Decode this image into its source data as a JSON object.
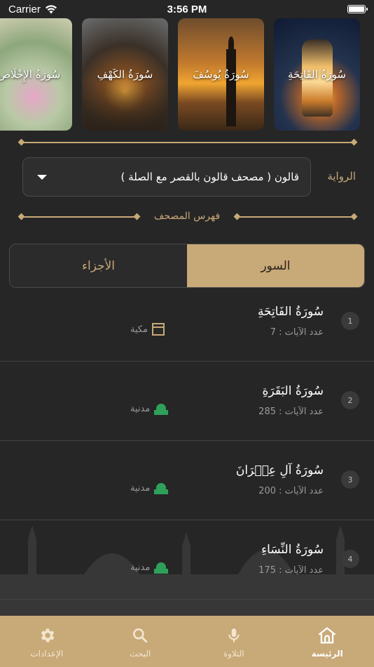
{
  "status_bar": {
    "carrier": "Carrier",
    "time": "3:56 PM"
  },
  "carousel": [
    {
      "title": "سُورَةُ الفَاتِحَةِ"
    },
    {
      "title": "سُورَةُ يُوسُفَ"
    },
    {
      "title": "سُورَةُ الكَهْفِ"
    },
    {
      "title": "سُورَةُ الإِخْلَاص"
    }
  ],
  "riwaya": {
    "label": "الرواية",
    "value": "قالون ( مصحف قالون بالقصر مع الصلة )"
  },
  "index_title": "فهرس المصحف",
  "segment": {
    "surahs": "السور",
    "juz": "الأجزاء",
    "active": "surahs"
  },
  "surahs": [
    {
      "num": "1",
      "name": "سُورَةُ الفَاتِحَةِ",
      "ayat": "عدد الآيات : 7",
      "type": "مكية",
      "icon": "kaaba-icon"
    },
    {
      "num": "2",
      "name": "سُورَةُ البَقَرَةِ",
      "ayat": "عدد الآيات : 285",
      "type": "مدنية",
      "icon": "mosque-icon"
    },
    {
      "num": "3",
      "name": "سُورَةُ آلِ عِمۡرَانَ",
      "ayat": "عدد الآيات : 200",
      "type": "مدنية",
      "icon": "mosque-icon"
    },
    {
      "num": "4",
      "name": "سُورَةُ النِّسَاءِ",
      "ayat": "عدد الآيات : 175",
      "type": "مدنية",
      "icon": "mosque-icon"
    }
  ],
  "tab_bar": {
    "home": "الرئيسة",
    "recitation": "التلاوة",
    "search": "البحث",
    "settings": "الإعدادات"
  },
  "colors": {
    "accent": "#c8a978",
    "background": "#262626",
    "madani_green": "#2fa05a"
  }
}
